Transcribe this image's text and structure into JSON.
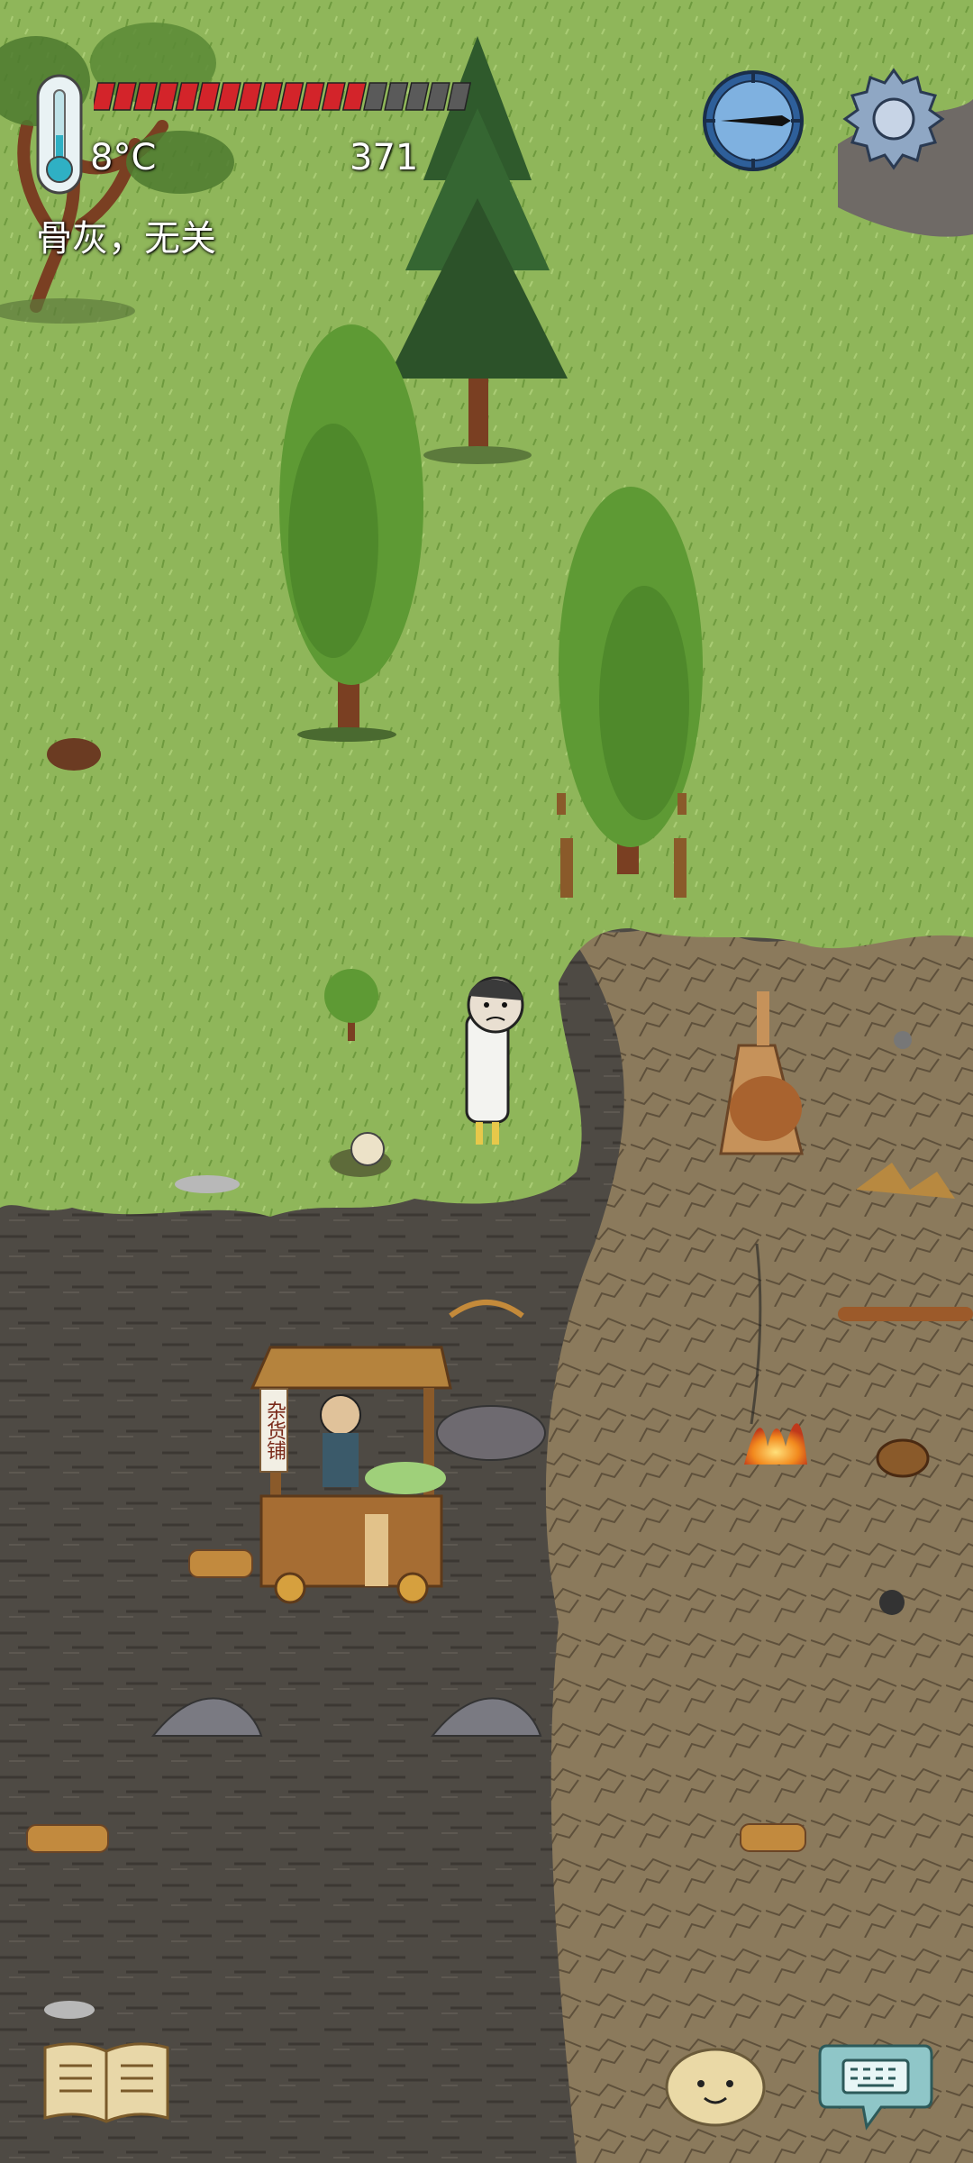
{
  "hud": {
    "temperature": "8°C",
    "counter": "371",
    "status_message": "骨灰，无关",
    "health_segments_total": 18,
    "health_segments_filled": 13,
    "colors": {
      "health_fill": "#d3242a",
      "health_empty": "#5a5a5a",
      "text": "#ffffff"
    }
  },
  "icons": {
    "thermometer": "thermometer-icon",
    "compass": "compass-icon",
    "settings": "gear-icon",
    "journal": "book-icon",
    "keyboard": "keyboard-chat-icon",
    "emote": "smiley-potato-icon"
  },
  "world": {
    "shop_sign": "杂货铺",
    "terrain_colors": {
      "grass": "#8fb65a",
      "mud": "#4e4a44",
      "dry_earth": "#8b7a5c"
    }
  }
}
